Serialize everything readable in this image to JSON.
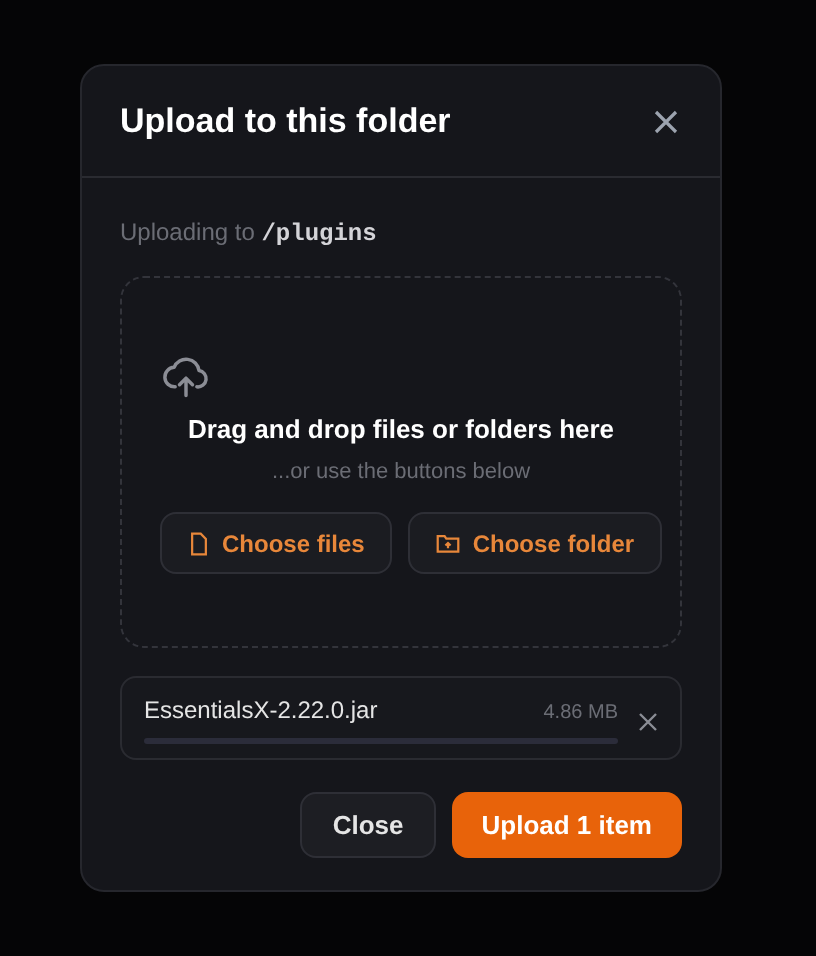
{
  "dialog": {
    "title": "Upload to this folder",
    "destination_label": "Uploading to",
    "destination_path": "/plugins"
  },
  "dropzone": {
    "heading": "Drag and drop files or folders here",
    "hint": "...or use the buttons below",
    "buttons": [
      {
        "kind": "files",
        "label": "Choose files"
      },
      {
        "kind": "folder",
        "label": "Choose folder"
      }
    ]
  },
  "files": [
    {
      "name": "EssentialsX-2.22.0.jar",
      "size": "4.86 MB",
      "level": 0
    }
  ],
  "buttons": [
    {
      "kind": "secondary",
      "label": "Close"
    },
    {
      "kind": "primary",
      "label": "Upload 1 item"
    }
  ]
}
